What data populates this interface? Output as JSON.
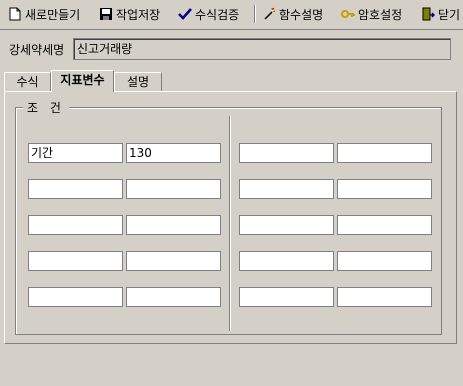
{
  "toolbar": {
    "new_label": "새로만들기",
    "save_label": "작업저장",
    "verify_label": "수식검증",
    "func_label": "함수설명",
    "password_label": "암호설정",
    "close_label": "닫기"
  },
  "form": {
    "name_label": "강세약세명",
    "name_value": "신고거래량"
  },
  "tabs": [
    {
      "label": "수식"
    },
    {
      "label": "지표변수"
    },
    {
      "label": "설명"
    }
  ],
  "conditions": {
    "legend": "조 건",
    "left": [
      [
        "기간",
        "130"
      ],
      [
        "",
        ""
      ],
      [
        "",
        ""
      ],
      [
        "",
        ""
      ],
      [
        "",
        ""
      ]
    ],
    "right": [
      [
        "",
        ""
      ],
      [
        "",
        ""
      ],
      [
        "",
        ""
      ],
      [
        "",
        ""
      ],
      [
        "",
        ""
      ]
    ]
  }
}
